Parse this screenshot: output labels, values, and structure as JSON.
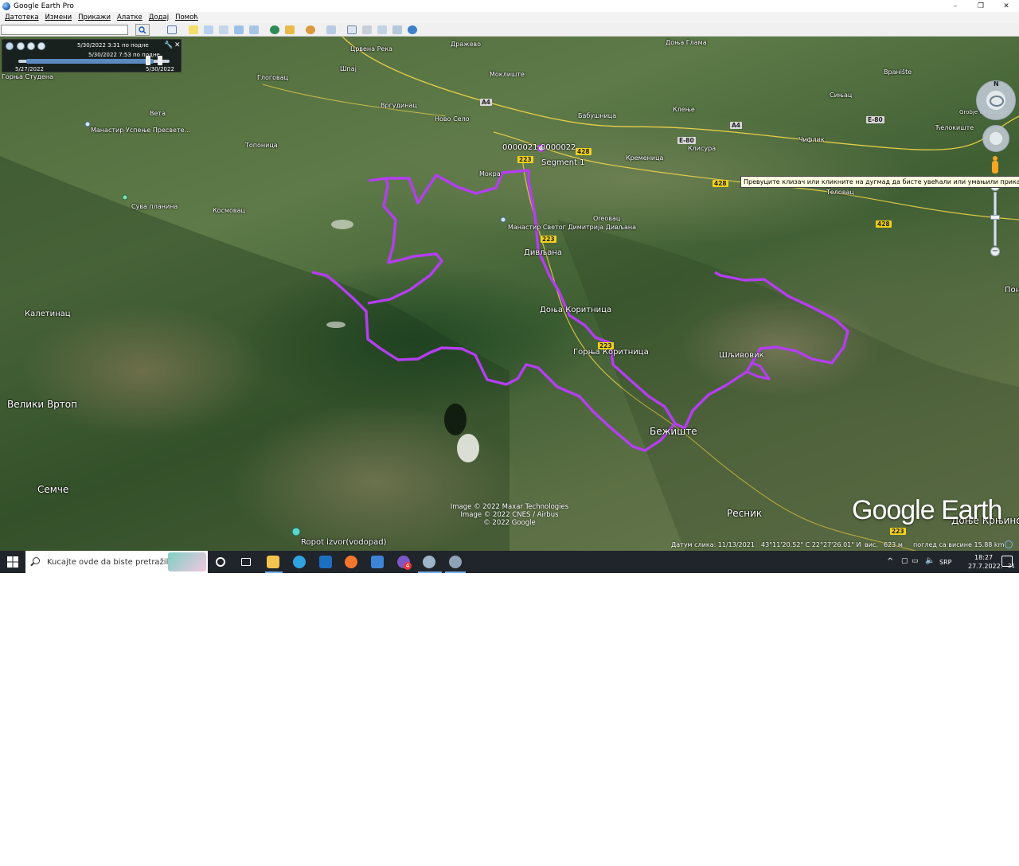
{
  "window": {
    "title": "Google Earth Pro",
    "minimize": "–",
    "maximize": "❐",
    "close": "✕"
  },
  "menu": [
    "Датотека",
    "Измени",
    "Прикажи",
    "Алатке",
    "Додај",
    "Помоћ"
  ],
  "search": {
    "placeholder": ""
  },
  "time_slider": {
    "current_start": "5/30/2022   3:31 по подне",
    "current_end": "5/30/2022   7:53 по подне",
    "range_start": "5/27/2022",
    "range_end": "5/30/2022"
  },
  "map": {
    "places": [
      {
        "name": "Горња Студена",
        "size": "s8"
      },
      {
        "name": "Глоговац",
        "size": "s8"
      },
      {
        "name": "Црвена Река",
        "size": "s8"
      },
      {
        "name": "Шпај",
        "size": "s8"
      },
      {
        "name": "Дражево",
        "size": "s8"
      },
      {
        "name": "Доња Глама",
        "size": "s8"
      },
      {
        "name": "Моклиште",
        "size": "s8"
      },
      {
        "name": "Вргудинац",
        "size": "s8"
      },
      {
        "name": "Вета",
        "size": "s8"
      },
      {
        "name": "Ново Село",
        "size": "s8"
      },
      {
        "name": "Бабушница",
        "size": "s8"
      },
      {
        "name": "Клење",
        "size": "s8"
      },
      {
        "name": "Вранište",
        "size": "s8"
      },
      {
        "name": "Сињац",
        "size": "s8"
      },
      {
        "name": "Манастир Успење Пресвете...",
        "size": "s8"
      },
      {
        "name": "Топоница",
        "size": "s8"
      },
      {
        "name": "Мокра",
        "size": "s8"
      },
      {
        "name": "Кременица",
        "size": "s8"
      },
      {
        "name": "Клисура",
        "size": "s8"
      },
      {
        "name": "Чифлик",
        "size": "s8"
      },
      {
        "name": "Ћелокиште",
        "size": "s8"
      },
      {
        "name": "Сува планина",
        "size": "s8"
      },
      {
        "name": "Космовац",
        "size": "s8"
      },
      {
        "name": "Оreовац",
        "size": "s8"
      },
      {
        "name": "Манастир Светог Димитрија Дивљана",
        "size": "s8"
      },
      {
        "name": "Теловац",
        "size": "s8"
      },
      {
        "name": "Дивљана",
        "size": "s10"
      },
      {
        "name": "Калетинац",
        "size": "s10"
      },
      {
        "name": "Доња Коритница",
        "size": "s10"
      },
      {
        "name": "Горња Коритница",
        "size": "s10"
      },
      {
        "name": "Шљивовик",
        "size": "s10"
      },
      {
        "name": "Велики Вртоп",
        "size": "s12"
      },
      {
        "name": "Бежиште",
        "size": "s12"
      },
      {
        "name": "Семче",
        "size": "s12"
      },
      {
        "name": "Ресник",
        "size": "s12"
      },
      {
        "name": "Ropot izvor(vodopad)",
        "size": "s10"
      },
      {
        "name": "Доње Крњино",
        "size": "s12"
      },
      {
        "name": "Пон",
        "size": "s10"
      },
      {
        "name": "Grobje Crnoklište",
        "size": "s8"
      }
    ],
    "waypoints": [
      "0000021",
      "0000022",
      "Segment 1"
    ],
    "road_shields": [
      "223",
      "223",
      "223",
      "223",
      "428",
      "428",
      "428",
      "E-80",
      "E-80",
      "A4",
      "A4"
    ],
    "track_color": "#b43ef0",
    "tooltip": "Превуците клизач или кликните на дугмад да бисте увећали или умањили приказ",
    "credits": [
      "Image © 2022 Maxar Technologies",
      "Image © 2022 CNES / Airbus",
      "© 2022 Google"
    ],
    "logo": "Google Earth",
    "nav_north": "N"
  },
  "status": {
    "date": "Датум слика: 11/13/2021",
    "coords": "43°11'20.52\" С    22°27'26.01\" И",
    "elev_label": "вис.",
    "elev": "623 м",
    "eye_alt": "поглед са висине  15.88 km"
  },
  "taskbar": {
    "search_placeholder": "Kucajte ovde da biste pretražili",
    "lang": "SRP",
    "time": "18:27",
    "date": "27.7.2022.",
    "notif": "21",
    "badge": "4"
  }
}
